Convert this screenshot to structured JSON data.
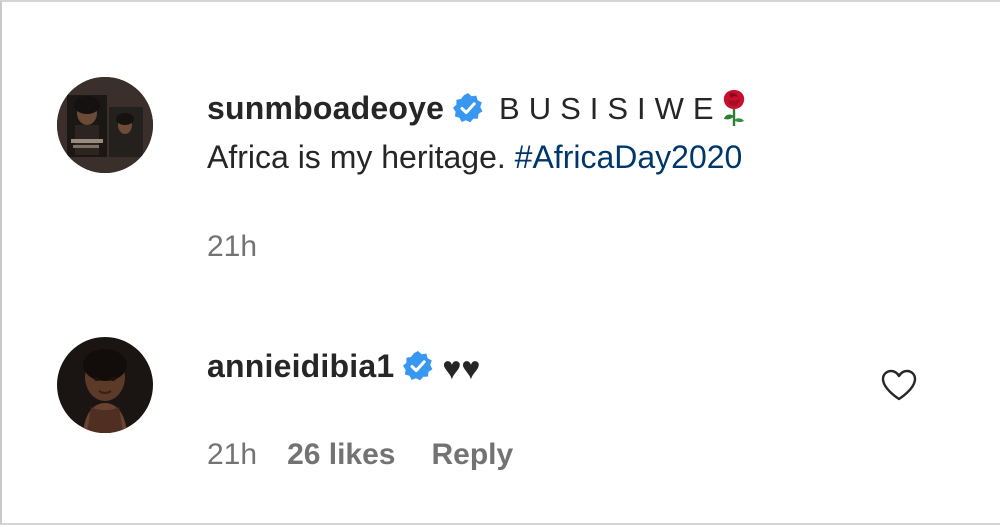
{
  "post_caption": {
    "username": "sunmboadeoye",
    "verified": true,
    "display_name": "BUSISIWE",
    "name_emoji": "rose-icon",
    "text": "Africa is my heritage. ",
    "hashtag": "#AfricaDay2020",
    "time": "21h"
  },
  "comments": [
    {
      "username": "annieidibia1",
      "verified": true,
      "text": "♥♥",
      "time": "21h",
      "likes": "26 likes",
      "reply_label": "Reply",
      "like_icon": "heart-outline-icon"
    }
  ],
  "colors": {
    "verified_badge": "#3897f0",
    "hashtag_link": "#00376b",
    "meta_text": "#737373",
    "primary_text": "#262626"
  }
}
